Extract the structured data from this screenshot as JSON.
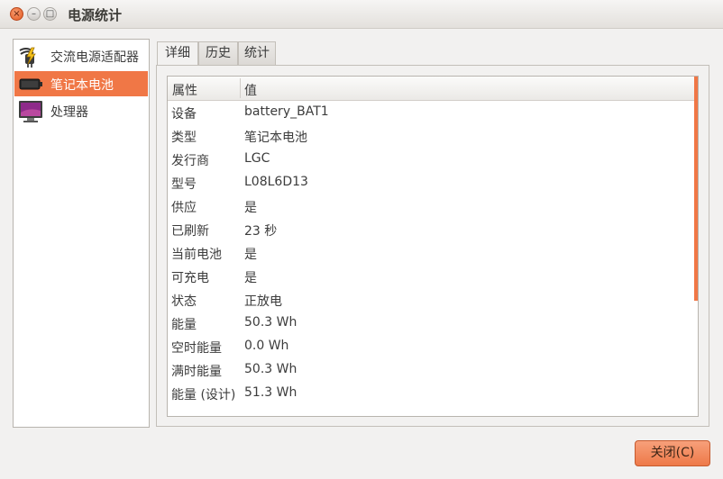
{
  "window": {
    "title": "电源统计",
    "close_glyph": "×",
    "minimize_glyph": "–",
    "maximize_glyph": "□"
  },
  "sidebar": {
    "items": [
      {
        "label": "交流电源适配器",
        "icon": "ac-adapter-icon"
      },
      {
        "label": "笔记本电池",
        "icon": "laptop-battery-icon",
        "selected": true
      },
      {
        "label": "处理器",
        "icon": "processor-monitor-icon"
      }
    ]
  },
  "tabs": [
    {
      "label": "详细",
      "active": true
    },
    {
      "label": "历史",
      "active": false
    },
    {
      "label": "统计",
      "active": false
    }
  ],
  "table": {
    "columns": [
      "属性",
      "值"
    ],
    "rows": [
      {
        "prop": "设备",
        "value": "battery_BAT1"
      },
      {
        "prop": "类型",
        "value": "笔记本电池"
      },
      {
        "prop": "发行商",
        "value": "LGC"
      },
      {
        "prop": "型号",
        "value": "L08L6D13"
      },
      {
        "prop": "供应",
        "value": "是"
      },
      {
        "prop": "已刷新",
        "value": "23 秒"
      },
      {
        "prop": "当前电池",
        "value": "是"
      },
      {
        "prop": "可充电",
        "value": "是"
      },
      {
        "prop": "状态",
        "value": "正放电"
      },
      {
        "prop": "能量",
        "value": "50.3 Wh"
      },
      {
        "prop": "空时能量",
        "value": "0.0 Wh"
      },
      {
        "prop": "满时能量",
        "value": "50.3 Wh"
      },
      {
        "prop": "能量 (设计)",
        "value": "51.3 Wh"
      }
    ]
  },
  "buttons": {
    "close_label": "关闭(C)"
  },
  "colors": {
    "accent": "#f07746",
    "window_bg": "#f2f1f0"
  }
}
